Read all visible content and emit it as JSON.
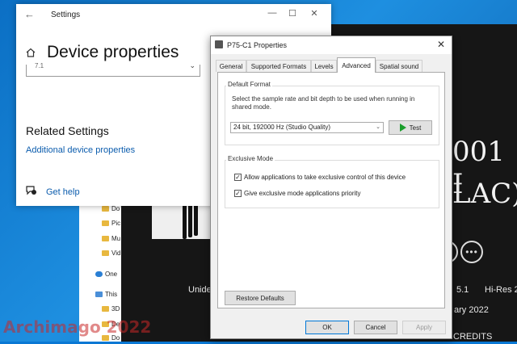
{
  "settings": {
    "title": "Settings",
    "page_title": "Device properties",
    "combo_partial_value": "7.1",
    "related_heading": "Related Settings",
    "additional_link": "Additional device properties",
    "help_link": "Get help"
  },
  "explorer": {
    "items": [
      {
        "label": "Do"
      },
      {
        "label": "Pic"
      },
      {
        "label": "Mu"
      },
      {
        "label": "Vid"
      },
      {
        "label": "One"
      },
      {
        "label": "This"
      },
      {
        "label": "3D"
      },
      {
        "label": "De"
      },
      {
        "label": "Do"
      }
    ]
  },
  "music": {
    "big_line1": "001 I",
    "big_line2": "LAC)",
    "artist_partial": "Unide",
    "format_partial": "5.1",
    "hires_partial": "Hi-Res 2",
    "date_partial": "ary 2022",
    "tracks_partial": "RACKS",
    "credits": "CREDITS",
    "more_icon": "more-dots-icon"
  },
  "dialog": {
    "title": "P75-C1 Properties",
    "tabs": [
      {
        "label": "General",
        "active": false
      },
      {
        "label": "Supported Formats",
        "active": false
      },
      {
        "label": "Levels",
        "active": false
      },
      {
        "label": "Advanced",
        "active": true
      },
      {
        "label": "Spatial sound",
        "active": false
      }
    ],
    "default_format": {
      "group_label": "Default Format",
      "description": "Select the sample rate and bit depth to be used when running in shared mode.",
      "selected": "24 bit, 192000 Hz (Studio Quality)",
      "test_button": "Test"
    },
    "exclusive_mode": {
      "group_label": "Exclusive Mode",
      "allow_label": "Allow applications to take exclusive control of this device",
      "allow_checked": true,
      "priority_label": "Give exclusive mode applications priority",
      "priority_checked": true
    },
    "restore_button": "Restore Defaults",
    "ok_button": "OK",
    "cancel_button": "Cancel",
    "apply_button": "Apply"
  },
  "watermark": "Archimago 2022"
}
